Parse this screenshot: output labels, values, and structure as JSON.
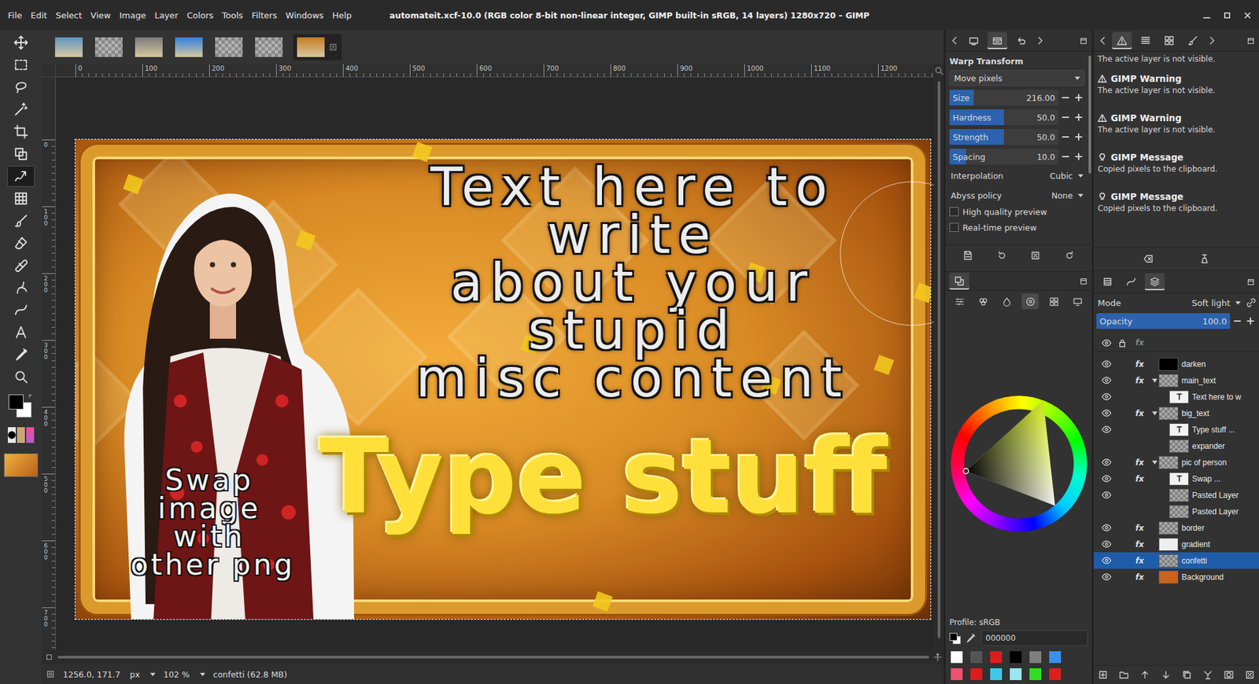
{
  "window": {
    "title": "automateit.xcf-10.0 (RGB color 8-bit non-linear integer, GIMP built-in sRGB, 14 layers) 1280x720 – GIMP"
  },
  "menu": [
    "File",
    "Edit",
    "Select",
    "View",
    "Image",
    "Layer",
    "Colors",
    "Tools",
    "Filters",
    "Windows",
    "Help"
  ],
  "toolbox": {
    "tools": [
      {
        "kind": "move",
        "selected": false
      },
      {
        "kind": "rect-select",
        "selected": false
      },
      {
        "kind": "lasso",
        "selected": false
      },
      {
        "kind": "fuzzy-select",
        "selected": false
      },
      {
        "kind": "crop",
        "selected": false
      },
      {
        "kind": "unified-transform",
        "selected": false
      },
      {
        "kind": "warp",
        "selected": true
      },
      {
        "kind": "pattern",
        "selected": false
      },
      {
        "kind": "paintbrush",
        "selected": false
      },
      {
        "kind": "eraser",
        "selected": false
      },
      {
        "kind": "heal",
        "selected": false
      },
      {
        "kind": "smudge",
        "selected": false
      },
      {
        "kind": "paths",
        "selected": false
      },
      {
        "kind": "text",
        "selected": false
      },
      {
        "kind": "color-picker",
        "selected": false
      },
      {
        "kind": "zoom",
        "selected": false
      }
    ],
    "fg": "#000000",
    "bg": "#ffffff"
  },
  "image_tabs": [
    {
      "kind": "photo",
      "color": "#5f95c2",
      "selected": false
    },
    {
      "kind": "checker",
      "color": "#9a9a9a",
      "selected": false
    },
    {
      "kind": "photo",
      "color": "#7a7a7a",
      "selected": false
    },
    {
      "kind": "photo",
      "color": "#2f7fe0",
      "selected": false
    },
    {
      "kind": "checker",
      "color": "#b04040",
      "selected": false
    },
    {
      "kind": "checker",
      "color": "#9a9a9a",
      "selected": false
    },
    {
      "kind": "photo",
      "color": "#c87a20",
      "selected": true
    }
  ],
  "rulers": {
    "horizontal": [
      "0",
      "100",
      "200",
      "300",
      "400",
      "500",
      "600",
      "700",
      "800",
      "900",
      "1000",
      "1100",
      "1200"
    ],
    "vertical": [
      "0",
      "100",
      "200",
      "300",
      "400",
      "500",
      "600",
      "700"
    ]
  },
  "canvas": {
    "main_text": [
      "Text here to",
      "write",
      "about your",
      "stupid",
      "misc content"
    ],
    "big_text": "Type stuff",
    "caption": [
      "Swap",
      "image",
      "with",
      "other png"
    ]
  },
  "status": {
    "coords": "1256.0, 171.7",
    "unit": "px",
    "zoom": "102 %",
    "layer_info": "confetti (62.8 MB)"
  },
  "tool_dock": {
    "tabs": [
      {
        "kind": "device",
        "selected": false
      },
      {
        "kind": "tool-options",
        "selected": true
      },
      {
        "kind": "undo",
        "selected": false
      }
    ]
  },
  "tool_options": {
    "title": "Warp Transform",
    "behavior": "Move pixels",
    "sliders": [
      {
        "label": "Size",
        "value": "216.00",
        "level": 0.22
      },
      {
        "label": "Hardness",
        "value": "50.0",
        "level": 0.5
      },
      {
        "label": "Strength",
        "value": "50.0",
        "level": 0.5
      },
      {
        "label": "Spacing",
        "value": "10.0",
        "level": 0.15
      }
    ],
    "dropdowns": [
      {
        "label": "Interpolation",
        "value": "Cubic"
      },
      {
        "label": "Abyss policy",
        "value": "None"
      }
    ],
    "checkboxes": [
      {
        "label": "High quality preview",
        "checked": false
      },
      {
        "label": "Real-time preview",
        "checked": false
      }
    ]
  },
  "colors": {
    "tabs": [
      {
        "kind": "fgbg",
        "selected": true
      }
    ],
    "selectors": [
      {
        "kind": "scales",
        "selected": false
      },
      {
        "kind": "cmyk",
        "selected": false
      },
      {
        "kind": "watercolor",
        "selected": false
      },
      {
        "kind": "wheel",
        "selected": true
      },
      {
        "kind": "palette",
        "selected": false
      },
      {
        "kind": "screen",
        "selected": false
      }
    ],
    "profile": "Profile: sRGB",
    "hex": "000000",
    "swatches": [
      {
        "color": "#ffffff"
      },
      {
        "color": "#555555"
      },
      {
        "color": "#e01b1b"
      },
      {
        "color": "#000000"
      },
      {
        "color": "#7f7f7f"
      },
      {
        "color": "#3b8ff0"
      },
      {
        "color": "#f0506e"
      },
      {
        "color": "#e01b1b"
      },
      {
        "color": "#3fc8e8"
      },
      {
        "color": "#9ae6f2"
      },
      {
        "color": "#33dd22"
      },
      {
        "color": "#dd1e1e"
      }
    ]
  },
  "message_dock": {
    "tabs": [
      {
        "kind": "warning",
        "selected": true
      },
      {
        "kind": "list",
        "selected": false
      },
      {
        "kind": "grid",
        "selected": false
      },
      {
        "kind": "paintbrush",
        "selected": false
      }
    ],
    "partial": "The active layer is not visible.",
    "items": [
      {
        "kind": "warning",
        "title": "GIMP Warning",
        "text": "The active layer is not visible."
      },
      {
        "kind": "warning",
        "title": "GIMP Warning",
        "text": "The active layer is not visible."
      },
      {
        "kind": "message",
        "title": "GIMP Message",
        "text": "Copied pixels to the clipboard."
      },
      {
        "kind": "message",
        "title": "GIMP Message",
        "text": "Copied pixels to the clipboard."
      }
    ]
  },
  "layers": {
    "tabs": [
      {
        "kind": "channels",
        "selected": false
      },
      {
        "kind": "paths",
        "selected": false
      },
      {
        "kind": "layers",
        "selected": true
      }
    ],
    "mode_label": "Mode",
    "mode": "Soft light",
    "opacity_label": "Opacity",
    "opacity": "100.0",
    "opacity_level": 1,
    "fx_label": "fx",
    "items": [
      {
        "name": "darken",
        "visible": true,
        "fx": true,
        "depth": 0,
        "kind": "fill",
        "color": "#000000",
        "expanded": false,
        "selected": false
      },
      {
        "name": "main_text",
        "visible": true,
        "fx": true,
        "depth": 0,
        "kind": "group",
        "expanded": true,
        "selected": false
      },
      {
        "name": "Text here to w",
        "visible": true,
        "fx": false,
        "depth": 1,
        "kind": "text",
        "expanded": false,
        "selected": false
      },
      {
        "name": "big_text",
        "visible": true,
        "fx": true,
        "depth": 0,
        "kind": "group",
        "expanded": true,
        "selected": false
      },
      {
        "name": "Type stuff ...",
        "visible": true,
        "fx": false,
        "depth": 1,
        "kind": "text",
        "expanded": false,
        "selected": false
      },
      {
        "name": "expander",
        "visible": false,
        "fx": false,
        "depth": 1,
        "kind": "pixels",
        "expanded": false,
        "selected": false
      },
      {
        "name": "pic of person",
        "visible": true,
        "fx": true,
        "depth": 0,
        "kind": "group",
        "expanded": true,
        "selected": false
      },
      {
        "name": "Swap ...",
        "visible": true,
        "fx": true,
        "depth": 1,
        "kind": "text",
        "expanded": false,
        "selected": false
      },
      {
        "name": "Pasted Layer",
        "visible": true,
        "fx": false,
        "depth": 1,
        "kind": "pixels",
        "expanded": false,
        "selected": false
      },
      {
        "name": "Pasted Layer",
        "visible": false,
        "fx": false,
        "depth": 1,
        "kind": "pixels",
        "expanded": false,
        "selected": false
      },
      {
        "name": "border",
        "visible": true,
        "fx": true,
        "depth": 0,
        "kind": "pixels",
        "expanded": false,
        "selected": false
      },
      {
        "name": "gradient",
        "visible": true,
        "fx": true,
        "depth": 0,
        "kind": "fill",
        "color": "#eeeeee",
        "expanded": false,
        "selected": false
      },
      {
        "name": "confetti",
        "visible": true,
        "fx": true,
        "depth": 0,
        "kind": "pixels",
        "expanded": false,
        "selected": true
      },
      {
        "name": "Background",
        "visible": true,
        "fx": true,
        "depth": 0,
        "kind": "fill",
        "color": "#c8641c",
        "expanded": false,
        "selected": false
      }
    ]
  }
}
